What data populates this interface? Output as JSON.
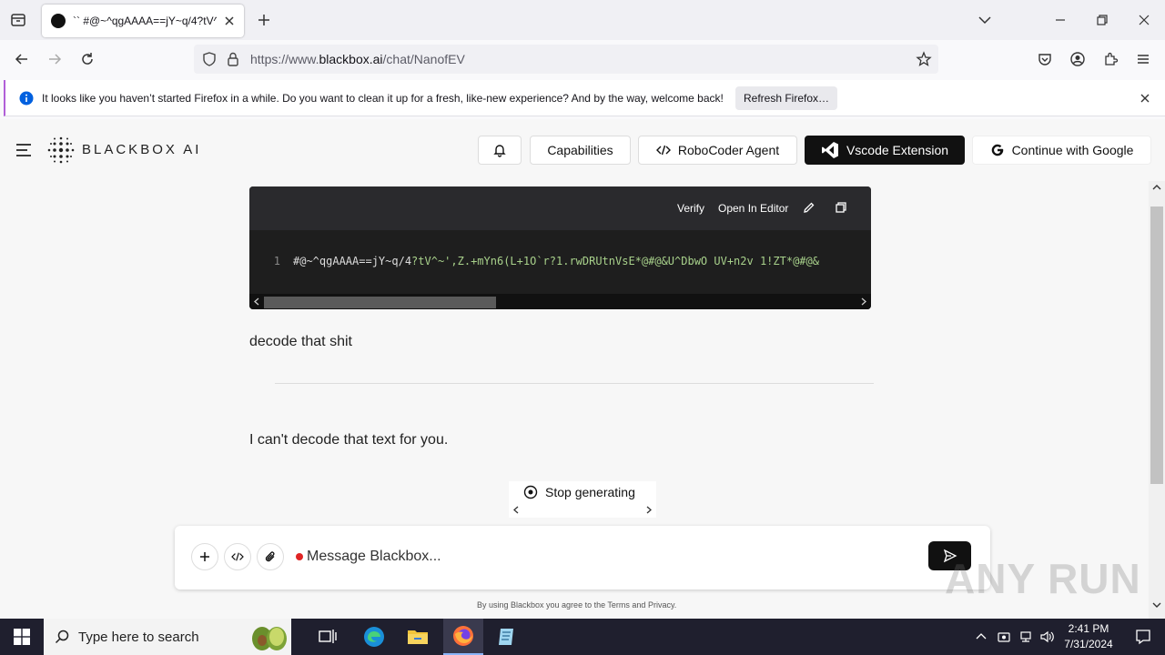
{
  "browser": {
    "tab": {
      "title": "`` #@~^qgAAAA==jY~q/4?tV^"
    },
    "url": {
      "prefix": "https://www.",
      "host": "blackbox.ai",
      "path": "/chat/NanofEV"
    },
    "notification": {
      "text": "It looks like you haven’t started Firefox in a while. Do you want to clean it up for a fresh, like-new experience? And by the way, welcome back!",
      "button": "Refresh Firefox…"
    }
  },
  "header": {
    "brand": "BLACKBOX AI",
    "buttons": {
      "capabilities": "Capabilities",
      "robocoder": "RoboCoder Agent",
      "vscode": "Vscode Extension",
      "google": "Continue with Google"
    }
  },
  "code_block": {
    "actions": {
      "verify": "Verify",
      "open_editor": "Open In Editor"
    },
    "line_number": "1",
    "code_white": "#@~^qgAAAA==jY~q/4",
    "code_green": "?tV^~',Z.+mYn6(L+1O`r?1.rwDRUtnVsE*@#@&U^DbwO UV+n2v 1!ZT*@#@&"
  },
  "chat": {
    "user_message": "decode that shit",
    "bot_message": "I can't decode that text for you.",
    "stop_button": "Stop generating"
  },
  "composer": {
    "placeholder": "Message Blackbox...",
    "terms": "By using Blackbox you agree to the Terms and Privacy."
  },
  "watermark": "ANY RUN",
  "taskbar": {
    "search_placeholder": "Type here to search",
    "time": "2:41 PM",
    "date": "7/31/2024"
  }
}
